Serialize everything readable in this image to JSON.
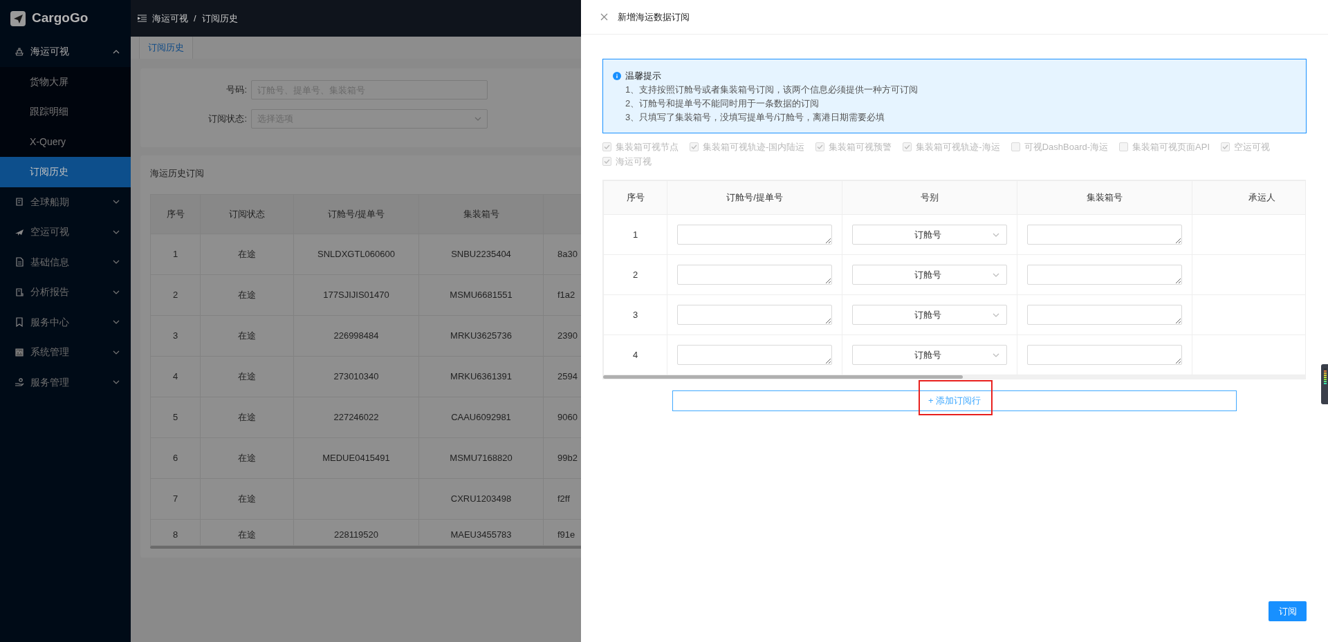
{
  "sidebar": {
    "logo": "CargoGo",
    "items": [
      {
        "label": "海运可视",
        "expanded": true,
        "children": [
          {
            "label": "货物大屏",
            "selected": false
          },
          {
            "label": "跟踪明细",
            "selected": false
          },
          {
            "label": "X-Query",
            "selected": false
          },
          {
            "label": "订阅历史",
            "selected": true
          }
        ]
      },
      {
        "label": "全球船期",
        "expanded": false
      },
      {
        "label": "空运可视",
        "expanded": false
      },
      {
        "label": "基础信息",
        "expanded": false
      },
      {
        "label": "分析报告",
        "expanded": false
      },
      {
        "label": "服务中心",
        "expanded": false
      },
      {
        "label": "系统管理",
        "expanded": false
      },
      {
        "label": "服务管理",
        "expanded": false
      }
    ]
  },
  "breadcrumb": {
    "separator": "/",
    "items": [
      "海运可视",
      "订阅历史"
    ]
  },
  "tabs": [
    {
      "label": "订阅历史",
      "selected": true
    }
  ],
  "filters": [
    {
      "kind": "text",
      "label": "号码:",
      "placeholder": "订舱号、提单号、集装箱号"
    },
    {
      "kind": "select",
      "label": "订阅状态:",
      "placeholder": "选择选项"
    }
  ],
  "history_table": {
    "title": "海运历史订阅",
    "columns": [
      "序号",
      "订阅状态",
      "订舱号/提单号",
      "集装箱号"
    ],
    "rows": [
      {
        "index": "1",
        "status": "在途",
        "booking_no": "SNLDXGTL060600",
        "container_no": "SNBU2235404",
        "column_5": "8a30"
      },
      {
        "index": "2",
        "status": "在途",
        "booking_no": "177SJIJIS01470",
        "container_no": "MSMU6681551",
        "column_5": "f1a2"
      },
      {
        "index": "3",
        "status": "在途",
        "booking_no": "226998484",
        "container_no": "MRKU3625736",
        "column_5": "2390"
      },
      {
        "index": "4",
        "status": "在途",
        "booking_no": "273010340",
        "container_no": "MRKU6361391",
        "column_5": "2594"
      },
      {
        "index": "5",
        "status": "在途",
        "booking_no": "227246022",
        "container_no": "CAAU6092981",
        "column_5": "9060"
      },
      {
        "index": "6",
        "status": "在途",
        "booking_no": "MEDUE0415491",
        "container_no": "MSMU7168820",
        "column_5": "99b2"
      },
      {
        "index": "7",
        "status": "在途",
        "container_no": "CXRU1203498",
        "column_5": "f2ff"
      },
      {
        "index": "8",
        "status": "在途",
        "booking_no": "228119520",
        "container_no": "MAEU3455783",
        "column_5": "f91e"
      }
    ]
  },
  "drawer": {
    "title": "新增海运数据订阅",
    "alert": {
      "title": "温馨提示",
      "lines": [
        "1、支持按照订舱号或者集装箱号订阅，该两个信息必须提供一种方可订阅",
        "2、订舱号和提单号不能同时用于一条数据的订阅",
        "3、只填写了集装箱号，没填写提单号/订舱号，离港日期需要必填"
      ]
    },
    "options": [
      {
        "label": "集装箱可视节点",
        "checked": true,
        "disabled": true
      },
      {
        "label": "集装箱可视轨迹-国内陆运",
        "checked": true,
        "disabled": true
      },
      {
        "label": "集装箱可视预警",
        "checked": true,
        "disabled": true
      },
      {
        "label": "集装箱可视轨迹-海运",
        "checked": true,
        "disabled": true
      },
      {
        "label": "可视DashBoard-海运",
        "checked": false,
        "disabled": true
      },
      {
        "label": "集装箱可视页面API",
        "checked": false,
        "disabled": true
      },
      {
        "label": "空运可视",
        "checked": true,
        "disabled": true
      },
      {
        "label": "海运可视",
        "checked": true,
        "disabled": true
      }
    ],
    "table": {
      "columns": [
        "序号",
        "订舱号/提单号",
        "号别",
        "集装箱号",
        "承运人"
      ],
      "rows": [
        {
          "index": "1",
          "number_type": "订舱号"
        },
        {
          "index": "2",
          "number_type": "订舱号"
        },
        {
          "index": "3",
          "number_type": "订舱号"
        },
        {
          "index": "4",
          "number_type": "订舱号"
        }
      ]
    },
    "add_row_button": "+ 添加订阅行",
    "submit_button": "订阅"
  }
}
